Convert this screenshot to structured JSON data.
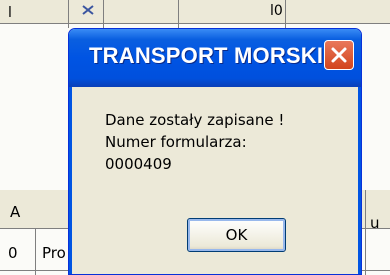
{
  "background": {
    "top_left_fragment": "l",
    "top_right_fragment": "l0",
    "column_header_left": "A",
    "column_header_right": "u",
    "row_cell_1": "0",
    "row_cell_2": "Pro"
  },
  "dialog": {
    "title": "TRANSPORT MORSKI",
    "message_lines": [
      "Dane zostały zapisane !",
      "Numer formularza:",
      "0000409"
    ],
    "ok_label": "OK",
    "close_icon": "close-x-icon"
  },
  "colors": {
    "titlebar_blue": "#0054e3",
    "close_red": "#d2441c",
    "dialog_face": "#ece9d8"
  }
}
